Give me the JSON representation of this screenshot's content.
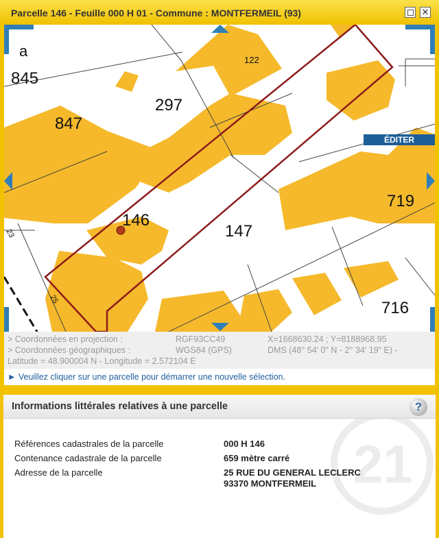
{
  "window": {
    "title": "Parcelle 146 - Feuille 000 H 01 - Commune : MONTFERMEIL (93)",
    "restore_icon": "restore-window-icon",
    "close_symbol": "✕",
    "close_icon": "close-icon"
  },
  "map": {
    "parcel_labels": {
      "p122": "122",
      "p845": "845",
      "p847": "847",
      "p297": "297",
      "p146": "146",
      "p147": "147",
      "p719": "719",
      "p716": "716",
      "pa": "a",
      "n23": "23",
      "n25": "25"
    },
    "selected_parcel": "146",
    "colors": {
      "building": "#f5b92b",
      "selected_outline": "#8b1a1a",
      "marker": "#b03a1b",
      "nav": "#2f7eb8"
    }
  },
  "coords": {
    "proj_label": "> Coordonnées en projection :",
    "proj_system": "RGF93CC49",
    "proj_value": "X=1668630.24 ; Y=8188968.95",
    "geo_label": "> Coordonnées géographiques :",
    "geo_system": "WGS84 (GPS)",
    "geo_value": "DMS (48° 54' 0\" N - 2° 34' 19\" E) -",
    "latlon": "Latitude = 48.900004 N - Longitude = 2.572104 E"
  },
  "hint": {
    "text": "► Veuillez cliquer sur une parcelle pour démarrer une nouvelle sélection."
  },
  "info_panel": {
    "title": "Informations littérales relatives à une parcelle",
    "help_symbol": "?",
    "rows": [
      {
        "label": "Références cadastrales de la parcelle",
        "value": "000 H 146"
      },
      {
        "label": "Contenance cadastrale de la parcelle",
        "value": "659 mètre carré"
      },
      {
        "label": "Adresse de la parcelle",
        "value": "25 RUE DU GENERAL LECLERC",
        "value2": "93370 MONTFERMEIL"
      }
    ],
    "edit_button": "ÉDITER",
    "watermark_text": "21"
  }
}
